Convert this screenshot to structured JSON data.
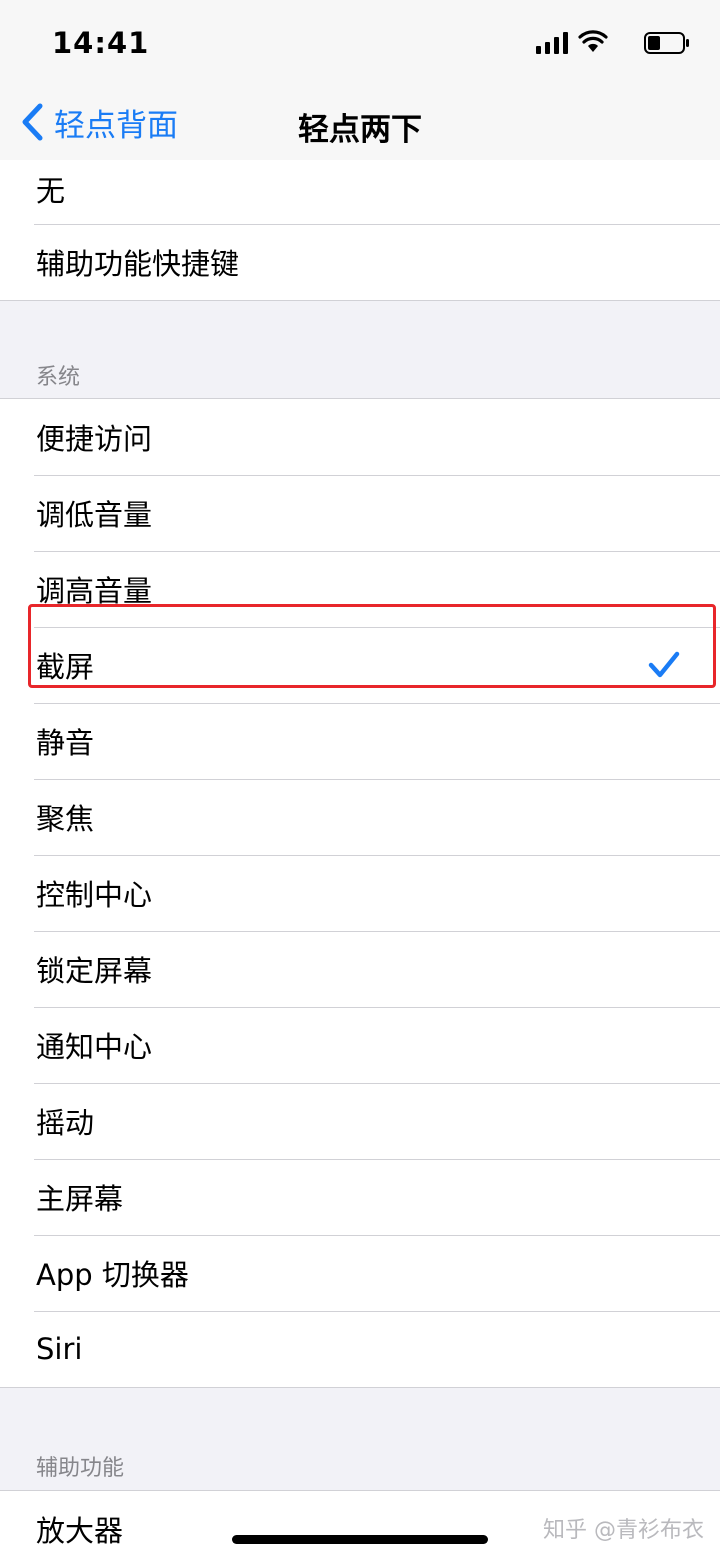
{
  "status_bar": {
    "time": "14:41",
    "signal_icon": "signal-bars-icon",
    "wifi_icon": "wifi-icon",
    "battery_icon": "battery-icon"
  },
  "nav": {
    "back_label": "轻点背面",
    "title": "轻点两下",
    "back_icon": "chevron-left-icon"
  },
  "top_items": [
    "无",
    "辅助功能快捷键"
  ],
  "system": {
    "header": "系统",
    "items": [
      "便捷访问",
      "调低音量",
      "调高音量",
      "截屏",
      "静音",
      "聚焦",
      "控制中心",
      "锁定屏幕",
      "通知中心",
      "摇动",
      "主屏幕",
      "App 切换器",
      "Siri"
    ],
    "selected": "截屏"
  },
  "accessibility": {
    "header": "辅助功能",
    "items": [
      "放大器"
    ]
  },
  "watermark": "知乎 @青衫布衣",
  "colors": {
    "accent": "#1a7cf5",
    "highlight": "#e8262a"
  }
}
